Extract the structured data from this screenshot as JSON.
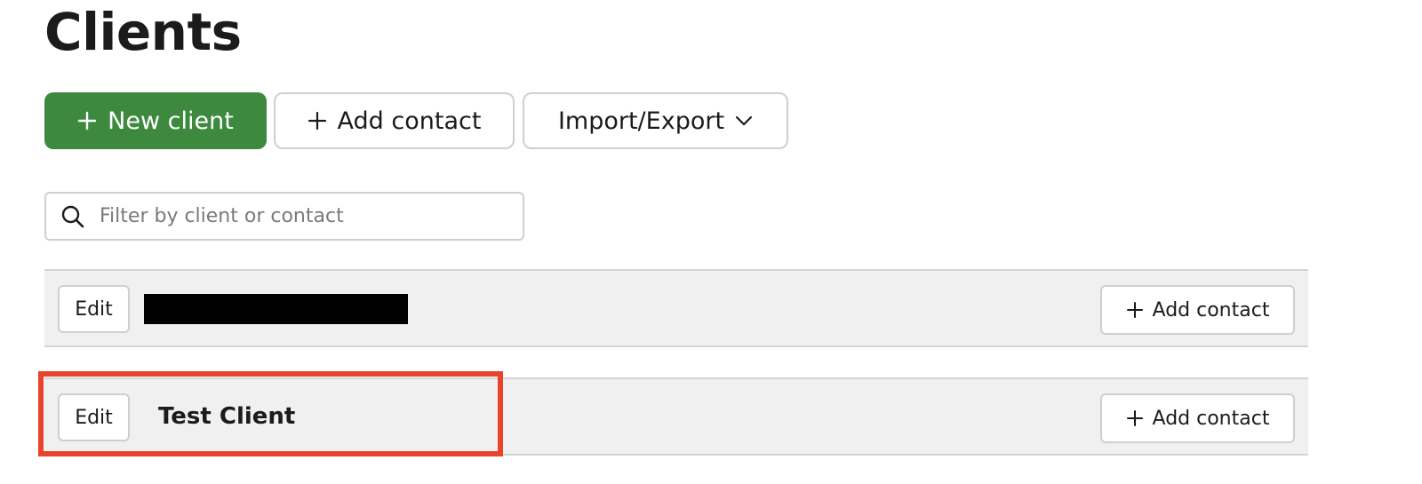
{
  "page": {
    "title": "Clients"
  },
  "toolbar": {
    "new_client_label": "New client",
    "add_contact_label": "Add contact",
    "import_export_label": "Import/Export",
    "primary_color": "#3d8a3f"
  },
  "search": {
    "placeholder": "Filter by client or contact",
    "value": ""
  },
  "clients": [
    {
      "edit_label": "Edit",
      "name": "",
      "name_redacted": true,
      "add_contact_label": "Add contact"
    },
    {
      "edit_label": "Edit",
      "name": "Test Client",
      "name_redacted": false,
      "add_contact_label": "Add contact",
      "highlighted": true
    }
  ],
  "highlight_color": "#e8442b",
  "icons": {
    "plus": "plus-icon",
    "chevron": "chevron-down-icon",
    "search": "search-icon"
  }
}
